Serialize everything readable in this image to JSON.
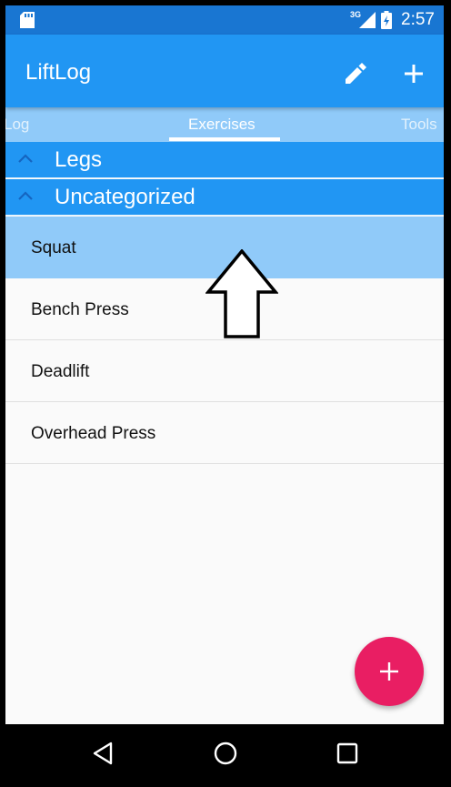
{
  "status_bar": {
    "network": "3G",
    "time": "2:57"
  },
  "app_bar": {
    "title": "LiftLog"
  },
  "tabs": [
    {
      "label": "Log",
      "selected": false
    },
    {
      "label": "Exercises",
      "selected": true
    },
    {
      "label": "Tools",
      "selected": false
    }
  ],
  "categories": [
    {
      "label": "Legs"
    },
    {
      "label": "Uncategorized"
    }
  ],
  "exercises": [
    {
      "label": "Squat",
      "selected": true
    },
    {
      "label": "Bench Press",
      "selected": false
    },
    {
      "label": "Deadlift",
      "selected": false
    },
    {
      "label": "Overhead Press",
      "selected": false
    }
  ],
  "colors": {
    "primary_dark": "#1976d2",
    "primary": "#2196f3",
    "primary_light": "#90caf9",
    "accent": "#e91e63",
    "background": "#fafafa"
  },
  "icons": {
    "edit": "pencil-icon",
    "add": "plus-icon",
    "fab": "plus-icon",
    "chevron": "chevron-up-icon",
    "back": "back-triangle-icon",
    "home": "home-circle-icon",
    "recents": "recents-square-icon"
  }
}
